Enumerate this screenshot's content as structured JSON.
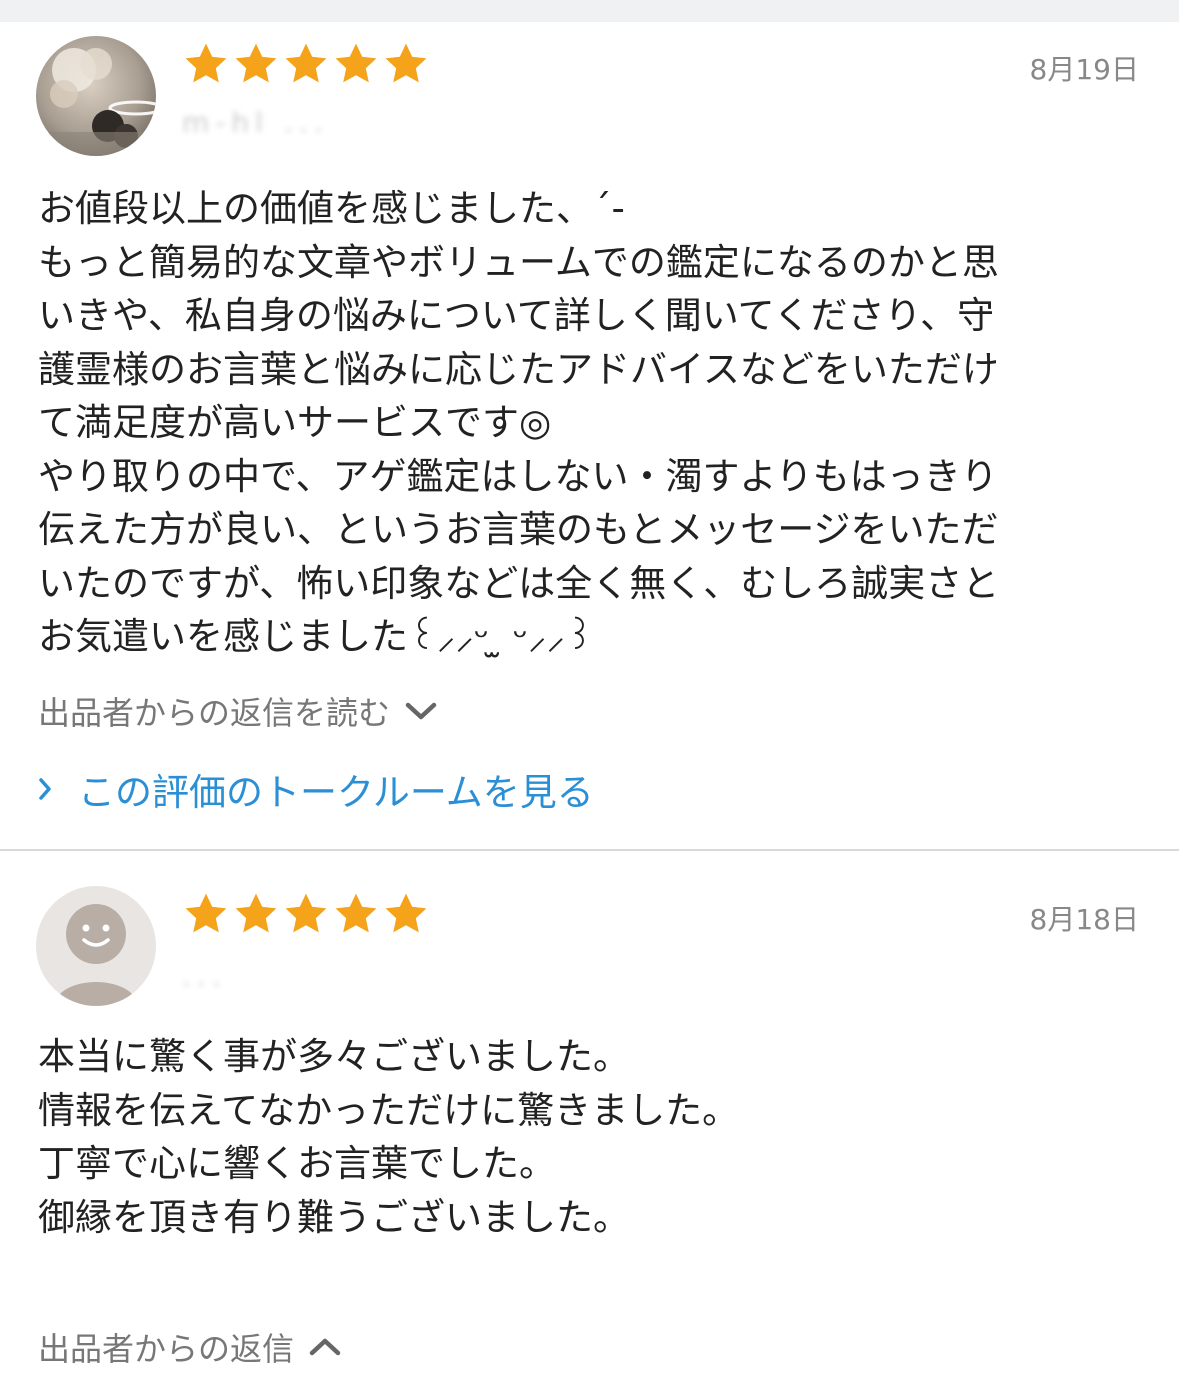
{
  "reviews": [
    {
      "rating": 5,
      "date": "8月19日",
      "reviewer_name": "m-hl ...",
      "body_lines": [
        "お値段以上の価値を感じました、´-",
        "もっと簡易的な文章やボリュームでの鑑定になるのかと思",
        "いきや、私自身の悩みについて詳しく聞いてくださり、守",
        "護霊様のお言葉と悩みに応じたアドバイスなどをいただけ",
        "て満足度が高いサービスです◎",
        "やり取りの中で、アゲ鑑定はしない・濁すよりもはっきり",
        "伝えた方が良い、というお言葉のもとメッセージをいただ",
        "いたのですが、怖い印象などは全く無く、むしろ誠実さと",
        "お気遣いを感じました꒰⸝⸝ᵕ ̫ ᵕ⸝⸝꒱"
      ],
      "reply_toggle_label": "出品者からの返信を読む",
      "talk_link_label": "この評価のトークルームを見る",
      "avatar": "photo-avatar"
    },
    {
      "rating": 5,
      "date": "8月18日",
      "reviewer_name": "...",
      "body_lines": [
        "本当に驚く事が多々ございました。",
        "情報を伝えてなかっただけに驚きました。",
        "丁寧で心に響くお言葉でした。",
        "御縁を頂き有り難うございました。"
      ],
      "reply_toggle_label": "出品者からの返信",
      "avatar": "default-smiley-avatar"
    }
  ],
  "colors": {
    "star": "#f5a31a",
    "link": "#2b8fd6",
    "muted": "#777777",
    "date": "#888888"
  }
}
